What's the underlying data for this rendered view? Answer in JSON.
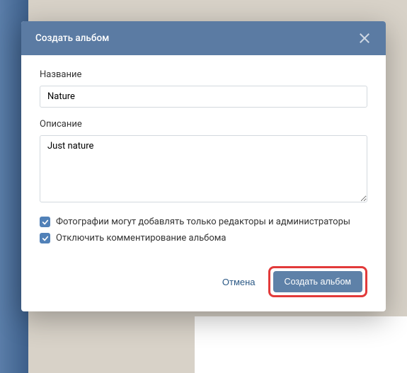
{
  "modal": {
    "title": "Создать альбом",
    "fields": {
      "name_label": "Название",
      "name_value": "Nature",
      "description_label": "Описание",
      "description_value": "Just nature"
    },
    "checkboxes": {
      "editors_only": "Фотографии могут добавлять только редакторы и администраторы",
      "disable_comments": "Отключить комментирование альбома"
    },
    "actions": {
      "cancel": "Отмена",
      "submit": "Создать альбом"
    }
  }
}
